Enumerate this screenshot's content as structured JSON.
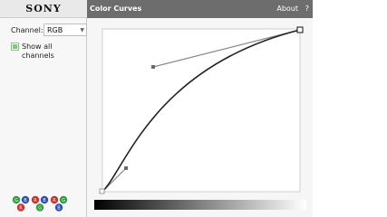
{
  "header": {
    "brand": "SONY",
    "title": "Color Curves",
    "about": "About",
    "help": "?"
  },
  "channel": {
    "label": "Channel:",
    "value": "RGB"
  },
  "show_all": {
    "label": "Show all channels",
    "checked": true
  },
  "icons": [
    {
      "name": "r-g-b-icon",
      "letters": [
        "G",
        "B",
        "R"
      ],
      "colors": [
        "#2e9e3e",
        "#2c4fb8",
        "#c9322d"
      ]
    },
    {
      "name": "r-b-g-icon",
      "letters": [
        "R",
        "B",
        "G"
      ],
      "colors": [
        "#c9322d",
        "#2c4fb8",
        "#2e9e3e"
      ]
    },
    {
      "name": "r-g-b2-icon",
      "letters": [
        "R",
        "G",
        "B"
      ],
      "colors": [
        "#c9322d",
        "#2e9e3e",
        "#2c4fb8"
      ]
    }
  ],
  "colors": {
    "title_bar": "#6d6d6d",
    "curve": "#222222",
    "handle_line": "#8a8a8a"
  }
}
